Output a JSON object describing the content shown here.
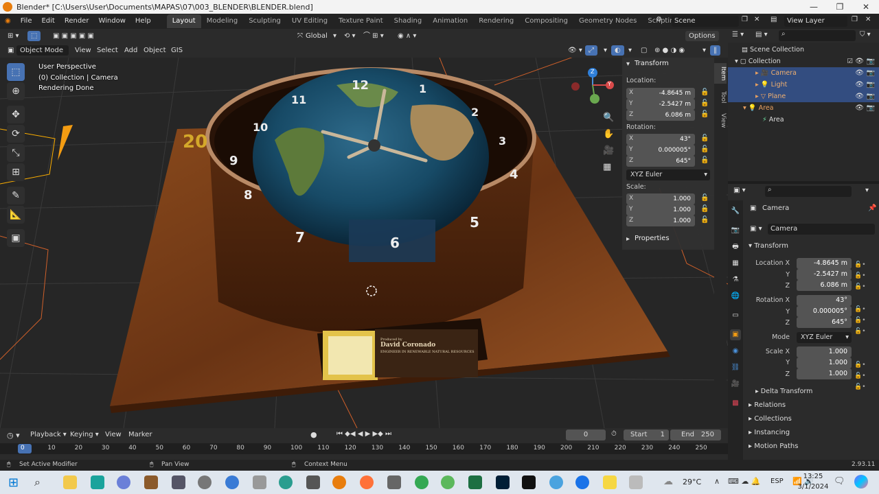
{
  "titlebar": {
    "title": "Blender* [C:\\Users\\User\\Documents\\MAPAS\\07\\003_BLENDER\\BLENDER.blend]"
  },
  "menu": {
    "items": [
      "File",
      "Edit",
      "Render",
      "Window",
      "Help"
    ],
    "workspaces": [
      "Layout",
      "Modeling",
      "Sculpting",
      "UV Editing",
      "Texture Paint",
      "Shading",
      "Animation",
      "Rendering",
      "Compositing",
      "Geometry Nodes",
      "Scripting"
    ],
    "active_workspace": "Layout",
    "scene": "Scene",
    "view_layer": "View Layer"
  },
  "tool_header": {
    "orientation": "Global",
    "options": "Options"
  },
  "viewport_header": {
    "mode": "Object Mode",
    "menus": [
      "View",
      "Select",
      "Add",
      "Object",
      "GIS"
    ]
  },
  "viewport": {
    "overlay_lines": [
      "User Perspective",
      "(0) Collection | Camera",
      "Rendering Done"
    ],
    "gizmo": {
      "z": "Z",
      "y": "Y"
    },
    "scene_text": {
      "produced_by": "Produced by",
      "author": "David Coronado",
      "subtitle": "ENGINEER IN RENEWABLE NATURAL RESOURCES",
      "year": "20",
      "clock_numbers": [
        "12",
        "1",
        "2",
        "3",
        "4",
        "5",
        "6",
        "7",
        "8",
        "9",
        "10",
        "11"
      ]
    }
  },
  "npanel": {
    "tabs": [
      "Item",
      "Tool",
      "View"
    ],
    "transform_title": "Transform",
    "location_label": "Location:",
    "location": [
      {
        "axis": "X",
        "value": "-4.8645 m"
      },
      {
        "axis": "Y",
        "value": "-2.5427 m"
      },
      {
        "axis": "Z",
        "value": "6.086 m"
      }
    ],
    "rotation_label": "Rotation:",
    "rotation": [
      {
        "axis": "X",
        "value": "43°"
      },
      {
        "axis": "Y",
        "value": "0.000005°"
      },
      {
        "axis": "Z",
        "value": "645°"
      }
    ],
    "rotation_mode": "XYZ Euler",
    "scale_label": "Scale:",
    "scale": [
      {
        "axis": "X",
        "value": "1.000"
      },
      {
        "axis": "Y",
        "value": "1.000"
      },
      {
        "axis": "Z",
        "value": "1.000"
      }
    ],
    "properties_title": "Properties"
  },
  "outliner": {
    "scene_collection": "Scene Collection",
    "collection": "Collection",
    "items": [
      "Camera",
      "Light",
      "Plane"
    ],
    "area_collection": "Area",
    "area_object": "Area"
  },
  "properties": {
    "object_name": "Camera",
    "data_name": "Camera",
    "transform_title": "Transform",
    "location": [
      {
        "label": "Location X",
        "value": "-4.8645 m"
      },
      {
        "label": "Y",
        "value": "-2.5427 m"
      },
      {
        "label": "Z",
        "value": "6.086 m"
      }
    ],
    "rotation": [
      {
        "label": "Rotation X",
        "value": "43°"
      },
      {
        "label": "Y",
        "value": "0.000005°"
      },
      {
        "label": "Z",
        "value": "645°"
      }
    ],
    "mode_label": "Mode",
    "mode_value": "XYZ Euler",
    "scale": [
      {
        "label": "Scale X",
        "value": "1.000"
      },
      {
        "label": "Y",
        "value": "1.000"
      },
      {
        "label": "Z",
        "value": "1.000"
      }
    ],
    "sections": [
      "Delta Transform",
      "Relations",
      "Collections",
      "Instancing",
      "Motion Paths"
    ]
  },
  "timeline": {
    "menus": [
      "Playback",
      "Keying",
      "View",
      "Marker"
    ],
    "current_frame": "0",
    "start_label": "Start",
    "start": "1",
    "end_label": "End",
    "end": "250",
    "ticks": [
      "0",
      "10",
      "20",
      "30",
      "40",
      "50",
      "60",
      "70",
      "80",
      "90",
      "100",
      "110",
      "120",
      "130",
      "140",
      "150",
      "160",
      "170",
      "180",
      "190",
      "200",
      "210",
      "220",
      "230",
      "240",
      "250"
    ]
  },
  "status": {
    "left": "Set Active Modifier",
    "mid": "Pan View",
    "right": "Context Menu",
    "version": "2.93.11"
  },
  "taskbar": {
    "weather": "29°C",
    "lang": "ESP",
    "time": "13:25",
    "date": "3/1/2024"
  }
}
